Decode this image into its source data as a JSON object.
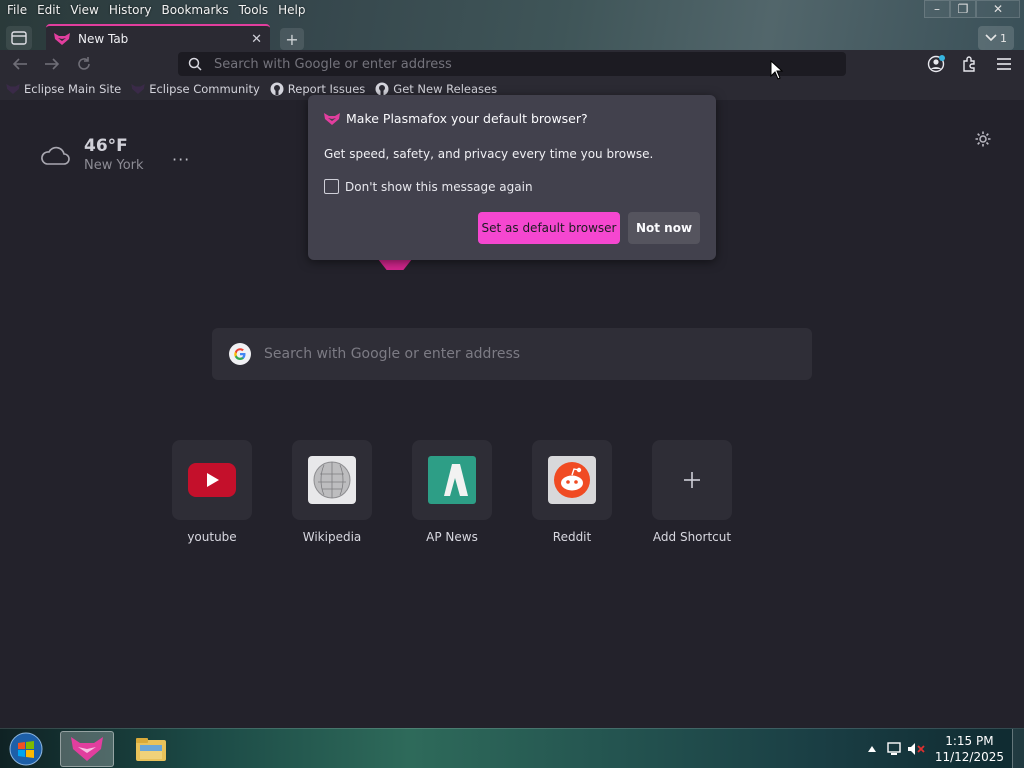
{
  "menubar": {
    "items": [
      "File",
      "Edit",
      "View",
      "History",
      "Bookmarks",
      "Tools",
      "Help"
    ]
  },
  "window_controls": {
    "minimize": "–",
    "maximize": "❐",
    "close": "✕"
  },
  "tabs": [
    {
      "title": "New Tab",
      "active": true
    }
  ],
  "tablist": {
    "count": "1"
  },
  "navbar": {
    "url_placeholder": "Search with Google or enter address"
  },
  "bookmarks": [
    {
      "label": "Eclipse Main Site",
      "icon": "plasmafox-icon"
    },
    {
      "label": "Eclipse Community",
      "icon": "plasmafox-icon"
    },
    {
      "label": "Report Issues",
      "icon": "github-icon"
    },
    {
      "label": "Get New Releases",
      "icon": "github-icon"
    }
  ],
  "weather": {
    "temperature": "46°F",
    "location": "New York",
    "more": "···"
  },
  "page_search": {
    "placeholder": "Search with Google or enter address"
  },
  "shortcuts": [
    {
      "label": "youtube",
      "icon": "youtube-icon"
    },
    {
      "label": "Wikipedia",
      "icon": "wikipedia-icon"
    },
    {
      "label": "AP News",
      "icon": "apnews-icon"
    },
    {
      "label": "Reddit",
      "icon": "reddit-icon"
    },
    {
      "label": "Add Shortcut",
      "icon": "plus-icon"
    }
  ],
  "dialog": {
    "title": "Make Plasmafox your default browser?",
    "description": "Get speed, safety, and privacy every time you browse.",
    "checkbox_label": "Don't show this message again",
    "checkbox_checked": false,
    "primary_button": "Set as default browser",
    "secondary_button": "Not now"
  },
  "taskbar": {
    "time": "1:15 PM",
    "date": "11/12/2025"
  },
  "colors": {
    "accent": "#f547d0",
    "brand": "#d4268e",
    "page_bg": "#23222b",
    "dialog_bg": "#42414d"
  }
}
